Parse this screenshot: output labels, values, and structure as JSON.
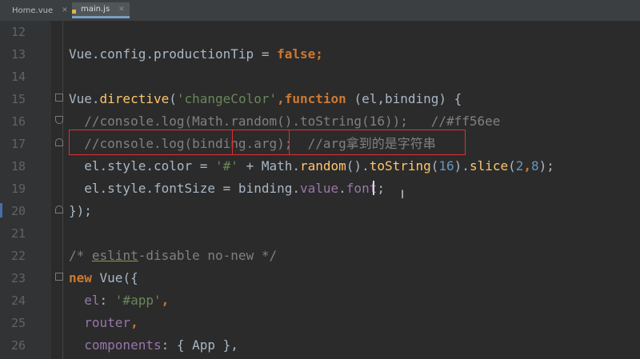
{
  "tabs": [
    {
      "label": "Home.vue",
      "icon": "vue-icon",
      "active": false
    },
    {
      "label": "main.js",
      "icon": "js-file-icon",
      "active": true
    }
  ],
  "line_numbers": [
    "12",
    "13",
    "14",
    "15",
    "16",
    "17",
    "18",
    "19",
    "20",
    "21",
    "22",
    "23",
    "24",
    "25",
    "26"
  ],
  "code": {
    "l13": {
      "a": "Vue.config.productionTip = ",
      "b": "false",
      "c": ";"
    },
    "l15": {
      "a": "Vue.",
      "b": "directive",
      "c": "(",
      "d": "'changeColor'",
      "e": ",",
      "f": "function",
      "g": " (el,binding) {"
    },
    "l16": {
      "a": "  //console.log(Math.random().toString(16));   //#ff56ee"
    },
    "l17": {
      "a": "  //console.log(binding.arg);  //arg拿到的是字符串"
    },
    "l18": {
      "a": "  el.style.color = ",
      "b": "'#'",
      "c": " + Math.",
      "d": "random",
      "e": "().",
      "f": "toString",
      "g": "(",
      "h": "16",
      "i": ").",
      "j": "slice",
      "k": "(",
      "l": "2",
      "m": ",",
      "n": "8",
      "o": ");"
    },
    "l19": {
      "a": "  el.style.fontSize = binding.",
      "b": "value",
      "c": ".",
      "d": "font",
      "e": ";"
    },
    "l20": {
      "a": "});"
    },
    "l22": {
      "a": "/* ",
      "b": "eslint",
      "c": "-disable no-new */"
    },
    "l23": {
      "a": "new",
      "b": " Vue({"
    },
    "l24": {
      "a": "  el",
      "b": ": ",
      "c": "'#app'",
      "d": ","
    },
    "l25": {
      "a": "  router",
      "b": ","
    },
    "l26": {
      "a": "  components",
      "b": ": { App },"
    }
  }
}
